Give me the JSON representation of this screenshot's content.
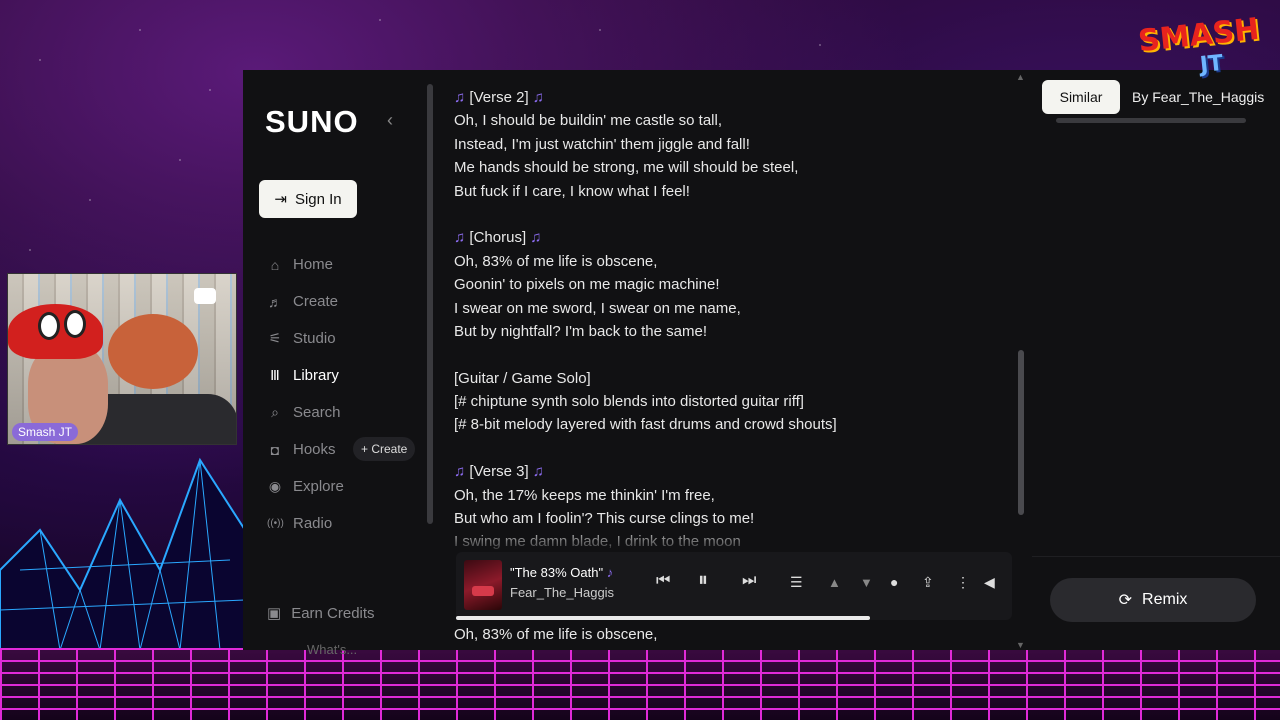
{
  "app": {
    "logo": "SUNO",
    "collapse_icon": "‹",
    "signin_label": "Sign In",
    "nav": [
      {
        "label": "Home",
        "icon": "home-icon",
        "glyph": "⌂"
      },
      {
        "label": "Create",
        "icon": "music-note-icon",
        "glyph": "♬"
      },
      {
        "label": "Studio",
        "icon": "studio-icon",
        "glyph": "⚟"
      },
      {
        "label": "Library",
        "icon": "library-icon",
        "glyph": "Ⅲ"
      },
      {
        "label": "Search",
        "icon": "search-icon",
        "glyph": "⌕"
      },
      {
        "label": "Hooks",
        "icon": "hooks-icon",
        "glyph": "◘"
      },
      {
        "label": "Explore",
        "icon": "explore-icon",
        "glyph": "◉"
      },
      {
        "label": "Radio",
        "icon": "radio-icon",
        "glyph": "((•))"
      }
    ],
    "hooks_create_label": "+ Create",
    "earn_label": "Earn Credits",
    "whats_label": "What's..."
  },
  "lyrics": [
    "🎶 [Verse 2] 🎶",
    "Oh, I should be buildin' me castle so tall,",
    "Instead, I'm just watchin' them jiggle and fall!",
    "Me hands should be strong, me will should be steel,",
    "But fuck if I care, I know what I feel!",
    "",
    "🎶 [Chorus] 🎶",
    "Oh, 83% of me life is obscene,",
    "Goonin' to pixels on me magic machine!",
    "I swear on me sword, I swear on me name,",
    "But by nightfall? I'm back to the same!",
    "",
    "[Guitar / Game Solo]",
    "[# chiptune synth solo blends into distorted guitar riff]",
    "[# 8-bit melody layered with fast drums and crowd shouts]",
    "",
    "🎶 [Verse 3] 🎶",
    "Oh, the 17% keeps me thinkin' I'm free,",
    "But who am I foolin'? This curse clings to me!",
    "I swing me damn blade, I drink to the moon"
  ],
  "bottom_line": "Oh, 83% of me life is obscene,",
  "player": {
    "title": "\"The 83% Oath\"",
    "title_note": "♪",
    "artist": "Fear_The_Haggis",
    "progress": 0.75
  },
  "right": {
    "tab_similar": "Similar",
    "tab_by": "By Fear_The_Haggis",
    "remix_label": "Remix"
  },
  "overlay": {
    "cam_name": "Smash JT",
    "logo_line1": "SMASH",
    "logo_line2": "JT"
  },
  "colors": {
    "accent_note": "#8c6cf0",
    "bg_app": "#111113",
    "floor_grid": "#e02ad8"
  }
}
